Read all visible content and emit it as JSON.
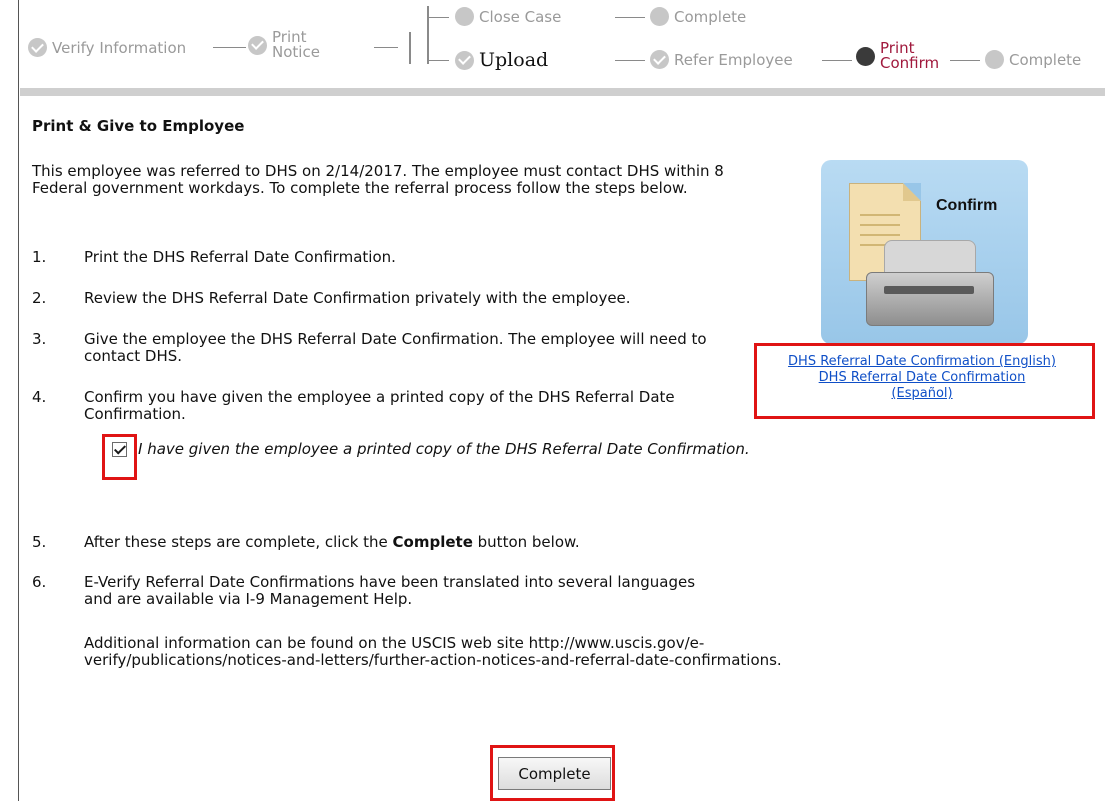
{
  "progress": {
    "steps": {
      "verify": "Verify Information",
      "print_notice": "Print\nNotice",
      "close_case": "Close Case",
      "complete_top": "Complete",
      "upload": "Upload",
      "refer": "Refer Employee",
      "print_confirm": "Print\nConfirm",
      "complete_right": "Complete"
    }
  },
  "section_title": "Print & Give to Employee",
  "intro": "This employee was referred to DHS on 2/14/2017. The employee must contact DHS within 8 Federal government workdays. To complete the referral process follow the steps below.",
  "steps": [
    {
      "num": "1.",
      "text": "Print the DHS Referral Date Confirmation."
    },
    {
      "num": "2.",
      "text": "Review the DHS Referral Date Confirmation privately with the employee."
    },
    {
      "num": "3.",
      "text": "Give the employee the DHS Referral Date Confirmation. The employee will need to contact DHS."
    },
    {
      "num": "4.",
      "text": "Confirm you have given the employee a printed copy of the DHS Referral Date Confirmation."
    },
    {
      "num": "5.",
      "text_pre": "After these steps are complete, click the ",
      "text_bold": "Complete",
      "text_post": " button below."
    },
    {
      "num": "6.",
      "text": "E-Verify Referral Date Confirmations have been translated into several languages and are available via I-9 Management Help."
    }
  ],
  "additional_info": "Additional information can be found on the USCIS web site http://www.uscis.gov/e-verify/publications/notices-and-letters/further-action-notices-and-referral-date-confirmations.",
  "acknowledgement": {
    "checked": true,
    "label": "I have given the employee a printed copy of the DHS Referral Date Confirmation."
  },
  "confirm_card": {
    "label": "Confirm",
    "icon": "document-printer-icon",
    "links": {
      "english": "DHS Referral Date Confirmation (English)",
      "spanish": "DHS Referral Date Confirmation (Español)"
    }
  },
  "complete_button": "Complete",
  "colors": {
    "highlight": "#e01414",
    "link": "#0f4fc7",
    "current_step": "#a0183c",
    "card": "#a8d0ee"
  }
}
